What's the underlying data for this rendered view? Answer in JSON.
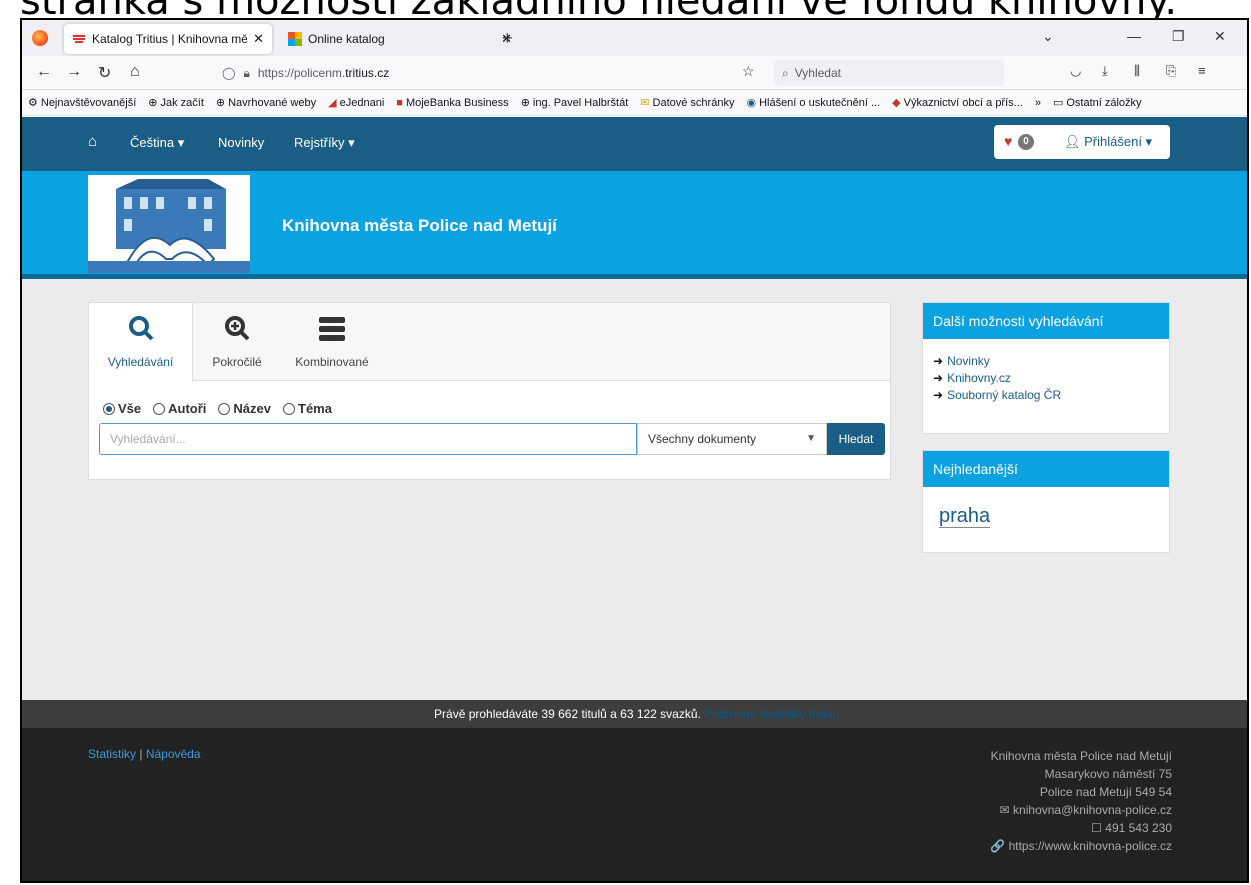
{
  "caption": "stránka s možností základního hledání ve fondu knihovny.",
  "browser": {
    "tabs": [
      {
        "title": "Katalog Tritius | Knihovna města Police nad Metují",
        "active": true
      },
      {
        "title": "Online katalog",
        "active": false
      }
    ],
    "url_prefix": "https://policenm.",
    "url_host": "tritius.cz",
    "search_placeholder": "Vyhledat",
    "bookmarks": [
      "Nejnavštěvovanější",
      "Jak začít",
      "Navrhované weby",
      "eJednani",
      "MojeBanka Business",
      "ing. Pavel Halbrštát",
      "Datové schránky",
      "Hlášení o uskutečnění ...",
      "Výkaznictví obcí a přís..."
    ],
    "bookmarks_more": "»",
    "other_bookmarks": "Ostatní záložky"
  },
  "site": {
    "nav": {
      "language": "Čeština ▾",
      "news": "Novinky",
      "registers": "Rejstříky ▾"
    },
    "favorites_count": "0",
    "login": "Přihlášení ▾",
    "library_name": "Knihovna města Police nad Metují",
    "search": {
      "tabs": [
        "Vyhledávání",
        "Pokročilé",
        "Kombinované"
      ],
      "radios": [
        "Vše",
        "Autoři",
        "Název",
        "Téma"
      ],
      "selected_radio": "Vše",
      "input_placeholder": "Vyhledávání...",
      "doc_type": "Všechny dokumenty",
      "button": "Hledat"
    },
    "more_options": {
      "title": "Další možnosti vyhledávání",
      "links": [
        "Novinky",
        "Knihovny.cz",
        "Souborný katalog ČR"
      ]
    },
    "popular": {
      "title": "Nejhledanější",
      "tags": [
        "praha"
      ]
    },
    "stats_text": "Právě prohledáváte 39 662 titulů a 63 122 svazků.",
    "stats_link": "Podrobné statistiky fondu",
    "footer": {
      "links": [
        "Statistiky",
        "Nápověda"
      ],
      "address": [
        "Knihovna města Police nad Metují",
        "Masarykovo náměstí 75",
        "Police nad Metují 549 54",
        "✉ knihovna@knihovna-police.cz",
        "☐ 491 543 230",
        "🔗 https://www.knihovna-police.cz"
      ]
    }
  }
}
